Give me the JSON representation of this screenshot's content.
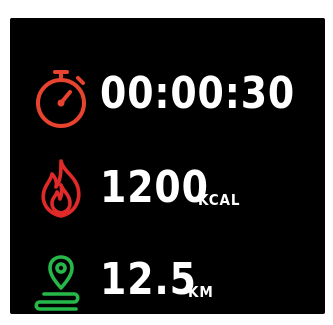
{
  "header_partial_text": "",
  "metrics": {
    "duration": {
      "icon": "stopwatch-icon",
      "value": "00:00:30"
    },
    "calories": {
      "icon": "flame-icon",
      "value": "1200",
      "unit": "KCAL"
    },
    "distance": {
      "icon": "route-pin-icon",
      "value": "12.5",
      "unit": "KM"
    }
  },
  "colors": {
    "background": "#000000",
    "text": "#ffffff",
    "stopwatch": "#e8432e",
    "flame": "#e02a2a",
    "route": "#27b84a"
  }
}
